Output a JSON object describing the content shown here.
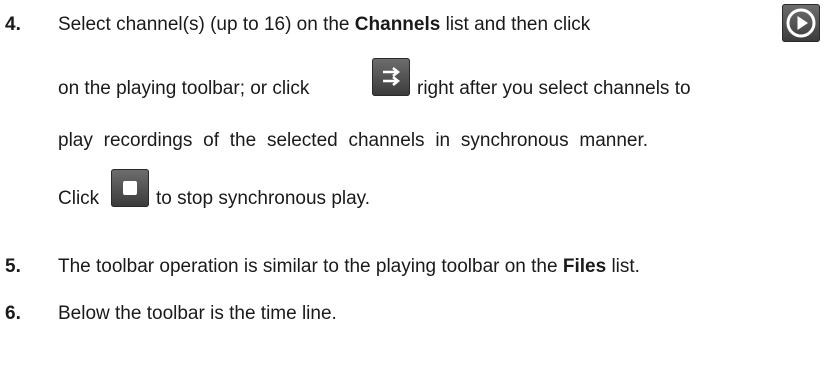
{
  "steps": [
    {
      "number": "4.",
      "line1_pre": "Select channel(s) (up to 16) on the ",
      "line1_bold": "Channels",
      "line1_post": " list and then click",
      "line2_pre": "on the playing toolbar; or click",
      "line2_post": "right after you select channels to",
      "line3": "play recordings of the selected channels in synchronous manner.",
      "line4_pre": "Click",
      "line4_post": "to stop synchronous play."
    },
    {
      "number": "5.",
      "text_pre": "The toolbar operation is similar to the playing toolbar on the ",
      "text_bold": "Files",
      "text_post": " list."
    },
    {
      "number": "6.",
      "text": "Below the toolbar is the time line."
    }
  ],
  "icons": {
    "play": "play-icon",
    "sync": "sync-play-icon",
    "stop": "stop-icon"
  }
}
